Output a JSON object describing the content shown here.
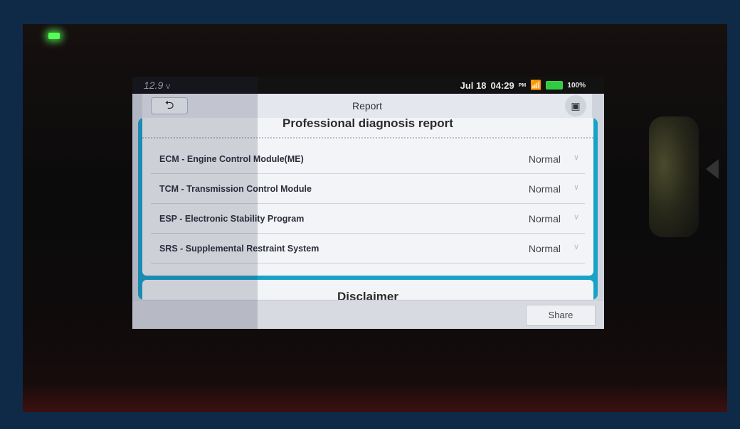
{
  "status_bar": {
    "voltage": "12.9",
    "voltage_unit": "V",
    "date": "Jul 18",
    "time": "04:29",
    "ampm": "PM",
    "battery": "100%",
    "wifi_icon": "wifi-icon",
    "battery_icon": "battery-icon"
  },
  "header": {
    "title": "Report",
    "back_icon": "back-arrow-icon",
    "camera_icon": "camera-icon"
  },
  "report": {
    "heading": "Professional diagnosis report",
    "modules": [
      {
        "name": "ECM - Engine Control Module(ME)",
        "status": "Normal"
      },
      {
        "name": "TCM - Transmission Control Module",
        "status": "Normal"
      },
      {
        "name": "ESP - Electronic Stability Program",
        "status": "Normal"
      },
      {
        "name": "SRS - Supplemental Restraint System",
        "status": "Normal"
      }
    ]
  },
  "disclaimer": {
    "heading": "Disclaimer"
  },
  "footer": {
    "share_label": "Share"
  },
  "colors": {
    "accent": "#19a2c8",
    "led": "#55ff55",
    "battery": "#2ecc40"
  }
}
